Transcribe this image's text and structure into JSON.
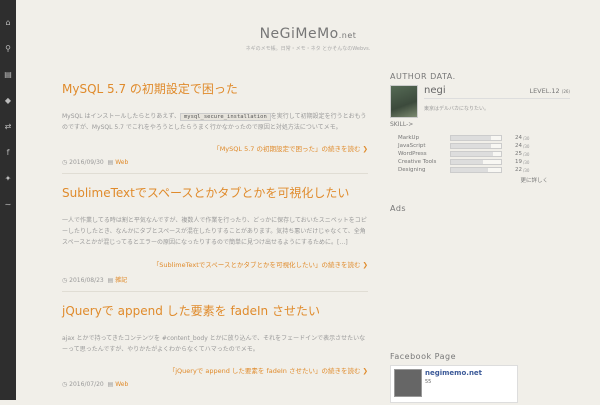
{
  "nav_icons": [
    "home-icon",
    "search-icon",
    "folder-icon",
    "tag-icon",
    "random-icon",
    "facebook-icon",
    "twitter-icon",
    "rss-icon"
  ],
  "header": {
    "title": "NeGiMeMo",
    "tld": ".net",
    "description": "ネギのメモ帳。日常・メモ・ネタ とかそんなのWebvs."
  },
  "articles": [
    {
      "title": "MySQL 5.7 の初期設定で困った",
      "body_before": "MySQL はインストールしたらとりあえず、",
      "code": "mysql_secure_installation",
      "body_after": "を実行して初期設定を行うとおもうのですが、MySQL 5.7 でこれをやろうとしたらうまく行かなかったので原因と対処方法についてメモ。",
      "readmore": "「MySQL 5.7 の初期設定で困った」の続きを読む",
      "date": "2016/09/30",
      "category": "Web"
    },
    {
      "title": "SublimeTextでスペースとかタブとかを可視化したい",
      "body_before": "一人で作業してる時は割と平気なんですが、複数人で作業を行ったり、どっかに保存しておいたスニペットをコピーしたりしたとき、なんかにタブとスペースが混在したりすることがあります。気持ち悪いだけじゃなくて、全角スペースとかが混じってるとエラーの原因になったりするので簡単に見つけ出せるようにするために。[…]",
      "code": "",
      "body_after": "",
      "readmore": "「SublimeTextでスペースとかタブとかを可視化したい」の続きを読む",
      "date": "2016/08/23",
      "category": "雑記"
    },
    {
      "title": "jQueryで append した要素を fadeIn させたい",
      "body_before": "ajax とかで持ってきたコンテンツを #content_body とかに放り込んで、それをフェードインで表示させたいなーって思ったんですが、やりかたがよくわからなくてハマったのでメモ。",
      "code": "",
      "body_after": "",
      "readmore": "「jQueryで append した要素を fadeIn させたい」の続きを読む",
      "date": "2016/07/20",
      "category": "Web"
    }
  ],
  "aside": {
    "author_heading": "AUTHOR DATA.",
    "author_name": "negi",
    "author_level": "LEVEL.12",
    "author_level_unit": "(26)",
    "author_desc": "東京はデルバカになりたい。",
    "skill_heading": "SKILL->",
    "skills": [
      {
        "name": "MarkUp",
        "value": "24",
        "max": "/30",
        "fraction": 0.8
      },
      {
        "name": "JavaScript",
        "value": "24",
        "max": "/30",
        "fraction": 0.8
      },
      {
        "name": "WordPress",
        "value": "25",
        "max": "/30",
        "fraction": 0.83
      },
      {
        "name": "Creative Tools",
        "value": "19",
        "max": "/30",
        "fraction": 0.63
      },
      {
        "name": "Designing",
        "value": "22",
        "max": "/30",
        "fraction": 0.73
      }
    ],
    "more_label": "更に詳しく",
    "ads_heading": "Ads",
    "fb_heading": "Facebook Page",
    "fb_name": "negimemo.net",
    "fb_likes": "55"
  }
}
